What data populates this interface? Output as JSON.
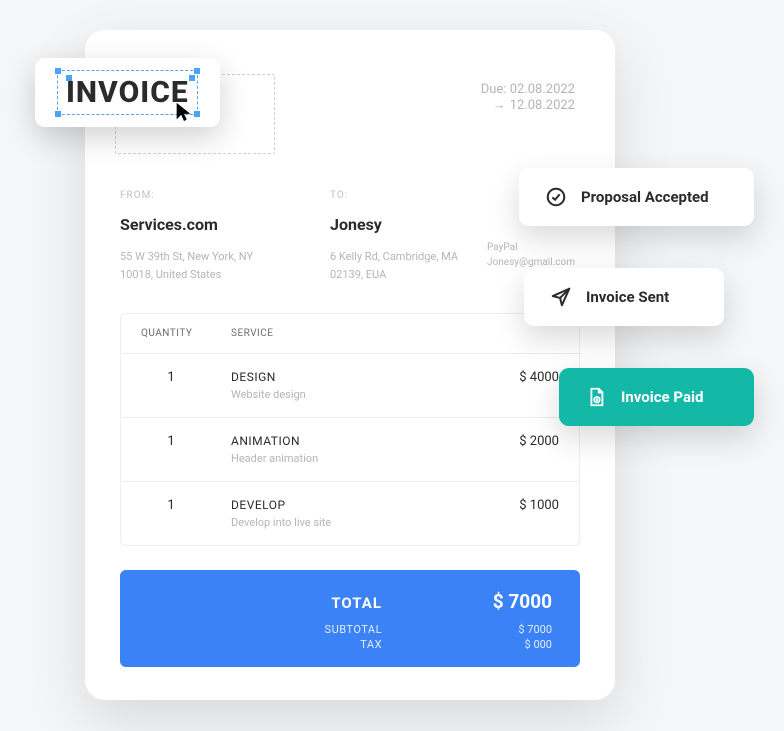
{
  "title": "INVOICE",
  "due": {
    "label": "Due:",
    "due_date": "02.08.2022",
    "issue_date": "12.08.2022"
  },
  "from": {
    "label": "FROM:",
    "name": "Services.com",
    "addr": "55 W 39th St, New York, NY 10018, United States"
  },
  "to": {
    "label": "TO:",
    "name": "Jonesy",
    "addr": "6 Kelly Rd, Cambridge, MA 02139, EUA"
  },
  "payment": {
    "method": "PayPal",
    "account": "Jonesy@gmail.com"
  },
  "table": {
    "headers": {
      "qty": "QUANTITY",
      "svc": "SERVICE"
    },
    "rows": [
      {
        "qty": "1",
        "name": "DESIGN",
        "desc": "Website design",
        "amount": "$ 4000"
      },
      {
        "qty": "1",
        "name": "ANIMATION",
        "desc": "Header animation",
        "amount": "$ 2000"
      },
      {
        "qty": "1",
        "name": "DEVELOP",
        "desc": "Develop into live site",
        "amount": "$ 1000"
      }
    ]
  },
  "totals": {
    "total_label": "TOTAL",
    "total_value": "$ 7000",
    "subtotal_label": "SUBTOTAL",
    "subtotal_value": "$ 7000",
    "tax_label": "TAX",
    "tax_value": "$  000"
  },
  "status": {
    "proposal": "Proposal Accepted",
    "sent": "Invoice Sent",
    "paid": "Invoice Paid"
  }
}
